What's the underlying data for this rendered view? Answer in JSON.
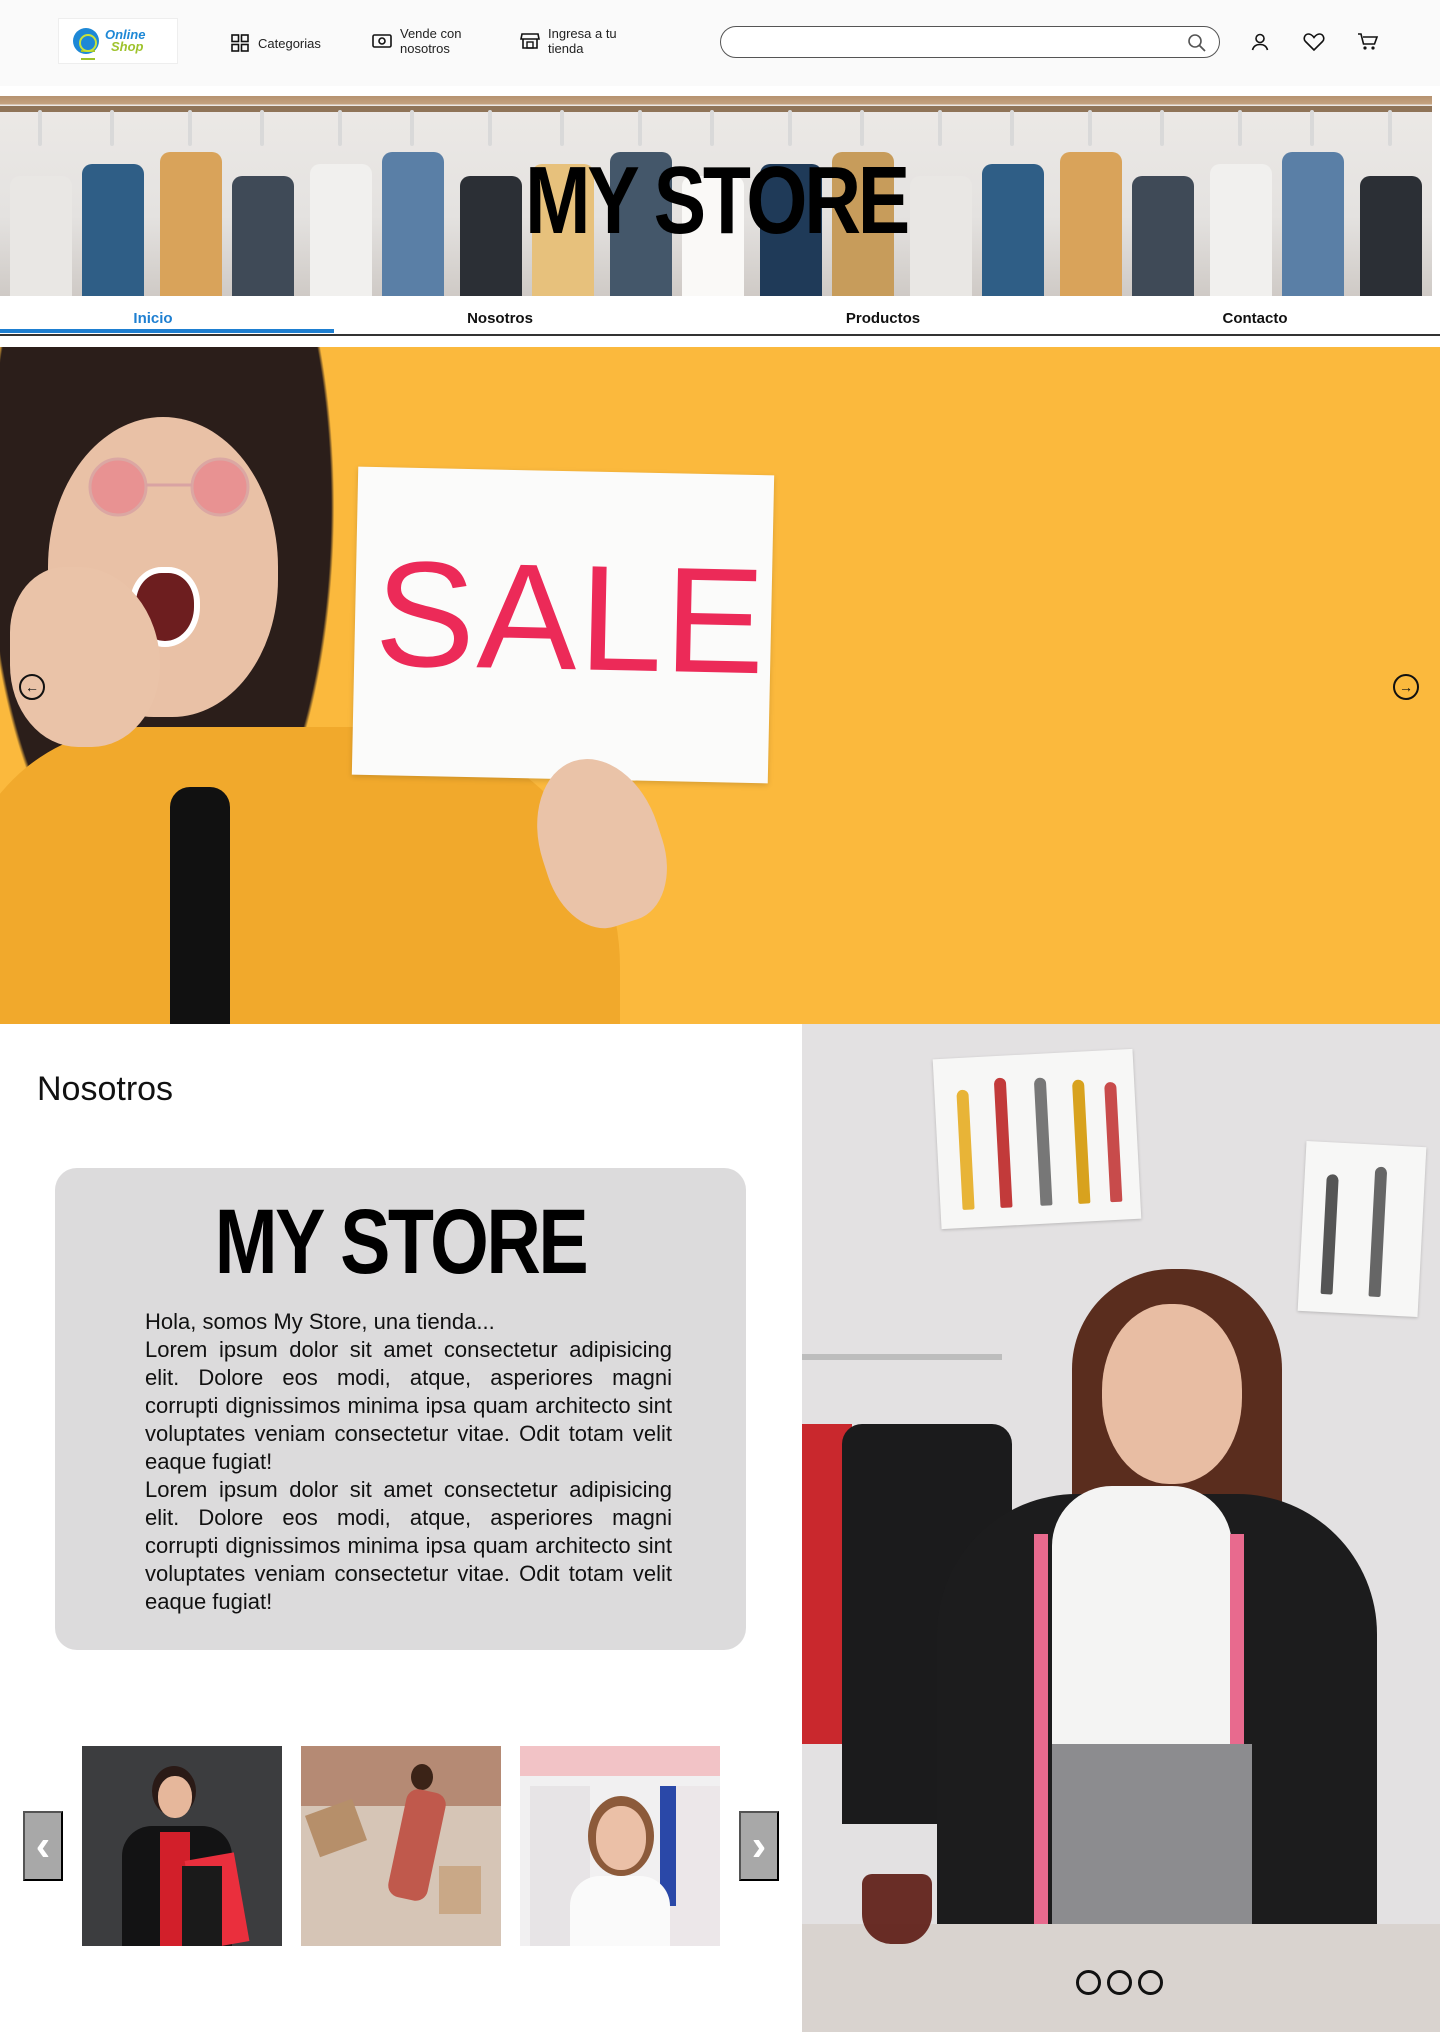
{
  "header": {
    "logo": {
      "line1": "Online",
      "line2": "Shop"
    },
    "nav": [
      {
        "label": "Categorias",
        "icon": "grid-icon"
      },
      {
        "label": "Vende con\nnosotros",
        "icon": "money-icon"
      },
      {
        "label": "Ingresa a tu\ntienda",
        "icon": "store-icon"
      }
    ],
    "search": {
      "placeholder": "",
      "value": ""
    },
    "icons": [
      "user-icon",
      "heart-icon",
      "cart-icon"
    ]
  },
  "banner": {
    "title": "MY STORE"
  },
  "tabs": {
    "active": "Inicio",
    "items": [
      "Inicio",
      "Nosotros",
      "Productos",
      "Contacto"
    ]
  },
  "hero": {
    "sign_text": "SALE",
    "prev_icon": "arrow-left-circle-icon",
    "next_icon": "arrow-right-circle-icon"
  },
  "about": {
    "section_title": "Nosotros",
    "card_title": "MY STORE",
    "intro": "Hola, somos My Store, una tienda...",
    "paragraph1": "Lorem ipsum dolor sit amet consectetur adipisicing elit. Dolore eos modi, atque, asperiores magni corrupti dignissimos minima ipsa quam architecto sint voluptates veniam consectetur vitae. Odit totam velit eaque fugiat!",
    "paragraph2": "Lorem ipsum dolor sit amet consectetur adipisicing elit. Dolore eos modi, atque, asperiores magni corrupti dignissimos minima ipsa quam architecto sint voluptates veniam consectetur vitae. Odit totam velit eaque fugiat!"
  },
  "thumbnails": {
    "prev_icon": "chevron-left-icon",
    "next_icon": "chevron-right-icon",
    "count": 3
  },
  "slider_dots": {
    "count": 3
  },
  "colors": {
    "accent": "#1e7fd1",
    "hero_bg": "#fbb93d",
    "sale_text": "#ec2a58",
    "card_bg": "#dcdbdc"
  }
}
